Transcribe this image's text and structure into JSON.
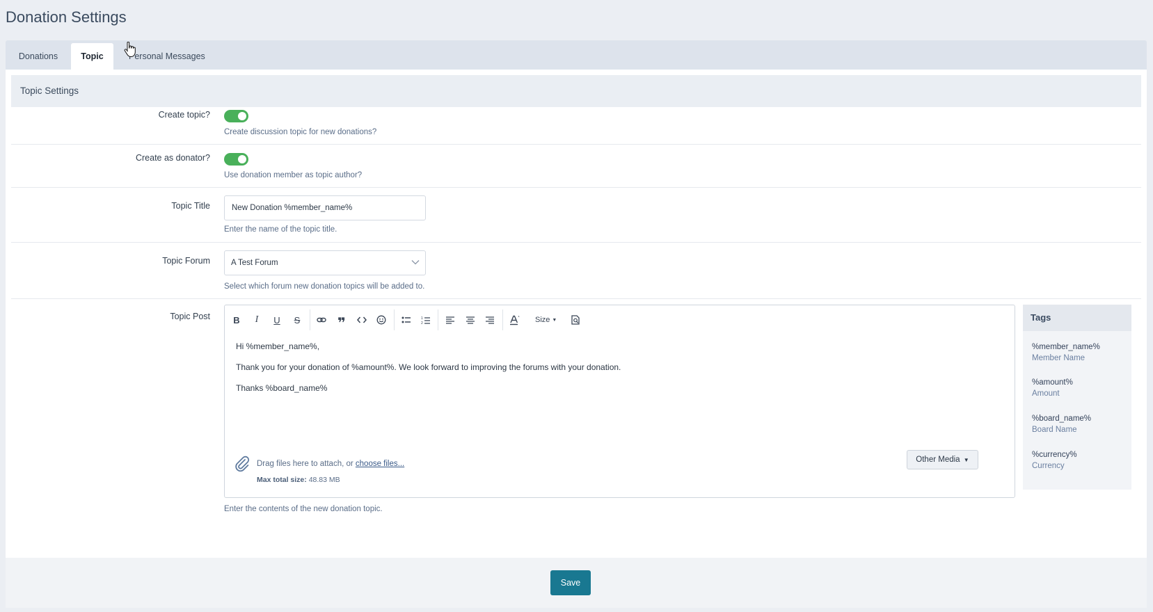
{
  "page": {
    "title": "Donation Settings"
  },
  "tabs": [
    {
      "label": "Donations",
      "active": false
    },
    {
      "label": "Topic",
      "active": true
    },
    {
      "label": "Personal Messages",
      "active": false
    }
  ],
  "section": {
    "title": "Topic Settings"
  },
  "fields": {
    "create_topic": {
      "label": "Create topic?",
      "enabled": true,
      "description": "Create discussion topic for new donations?"
    },
    "create_as_donator": {
      "label": "Create as donator?",
      "enabled": true,
      "description": "Use donation member as topic author?"
    },
    "topic_title": {
      "label": "Topic Title",
      "value": "New Donation %member_name%",
      "description": "Enter the name of the topic title."
    },
    "topic_forum": {
      "label": "Topic Forum",
      "selected": "A Test Forum",
      "description": "Select which forum new donation topics will be added to."
    },
    "topic_post": {
      "label": "Topic Post",
      "description": "Enter the contents of the new donation topic."
    }
  },
  "editor": {
    "toolbar": {
      "bold": "B",
      "italic": "I",
      "underline": "U",
      "strike": "S",
      "link_icon": "link-icon",
      "quote_icon": "quote-icon",
      "code_icon": "code-icon",
      "emoji_icon": "emoji-icon",
      "bullet_list_icon": "bullet-list-icon",
      "numbered_list_icon": "numbered-list-icon",
      "align_left_icon": "align-left-icon",
      "align_center_icon": "align-center-icon",
      "align_right_icon": "align-right-icon",
      "font_color_icon": "font-color-icon",
      "size_label": "Size",
      "preview_icon": "preview-icon"
    },
    "content": [
      "Hi %member_name%,",
      "Thank you for your donation of %amount%. We look forward to improving the forums with your donation.",
      "Thanks %board_name%"
    ],
    "attach": {
      "drop_text": "Drag files here to attach, or ",
      "choose_link": "choose files...",
      "max_label": "Max total size:",
      "max_value": "48.83 MB"
    },
    "other_media": "Other Media"
  },
  "tags": {
    "title": "Tags",
    "items": [
      {
        "code": "%member_name%",
        "name": "Member Name"
      },
      {
        "code": "%amount%",
        "name": "Amount"
      },
      {
        "code": "%board_name%",
        "name": "Board Name"
      },
      {
        "code": "%currency%",
        "name": "Currency"
      }
    ]
  },
  "actions": {
    "save": "Save"
  },
  "colors": {
    "toggle_on": "#49b05a",
    "save_button": "#197891",
    "background": "#ebeef3"
  }
}
